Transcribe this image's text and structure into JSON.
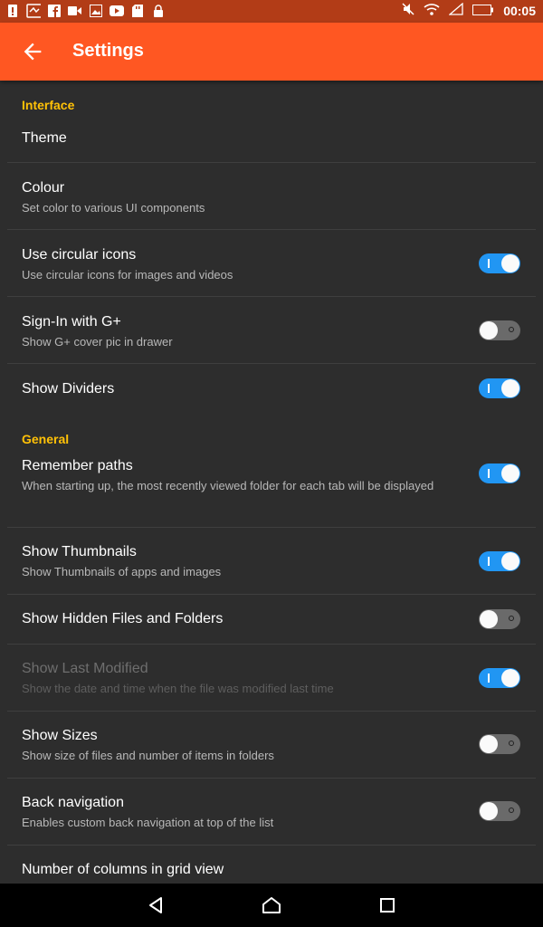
{
  "status_bar": {
    "time": "00:05",
    "left_icons": [
      "alert-icon",
      "usb-icon",
      "facebook-icon",
      "video-icon",
      "image-icon",
      "youtube-icon",
      "sd-card-icon",
      "lock-icon"
    ],
    "right_icons": [
      "mute-icon",
      "wifi-icon",
      "signal-icon",
      "battery-icon"
    ]
  },
  "app_bar": {
    "title": "Settings",
    "back_icon": "arrow-back-icon"
  },
  "sections": [
    {
      "header": "Interface"
    },
    {
      "header": "General"
    }
  ],
  "items": [
    {
      "title": "Theme",
      "subtitle": ""
    },
    {
      "title": "Colour",
      "subtitle": "Set color to various UI components"
    },
    {
      "title": "Use circular icons",
      "subtitle": "Use circular icons for images and videos",
      "toggle": true
    },
    {
      "title": "Sign-In with G+",
      "subtitle": "Show G+ cover pic in drawer",
      "toggle": false
    },
    {
      "title": "Show Dividers",
      "subtitle": "",
      "toggle": true
    },
    {
      "title": "Remember paths",
      "subtitle": "When starting up, the most recently viewed folder for each tab will be displayed",
      "toggle": true
    },
    {
      "title": "Show Thumbnails",
      "subtitle": "Show Thumbnails of apps and images",
      "toggle": true
    },
    {
      "title": "Show Hidden Files and Folders",
      "subtitle": "",
      "toggle": false
    },
    {
      "title": "Show Last Modified",
      "subtitle": "Show the date and time when the file was modified last time",
      "toggle": true,
      "disabled": true
    },
    {
      "title": "Show Sizes",
      "subtitle": "Show size of files and number of items in folders",
      "toggle": false
    },
    {
      "title": "Back navigation",
      "subtitle": "Enables custom back navigation at top of the list",
      "toggle": false
    },
    {
      "title": "Number of columns in grid view",
      "subtitle": ""
    }
  ],
  "colors": {
    "accent": "#ff5722",
    "status_bar": "#b23c17",
    "section_header": "#ffc107",
    "switch_on": "#2196f3",
    "background": "#2d2d2d"
  },
  "nav_bar": {
    "icons": [
      "back-triangle-icon",
      "home-icon",
      "recents-icon"
    ]
  }
}
